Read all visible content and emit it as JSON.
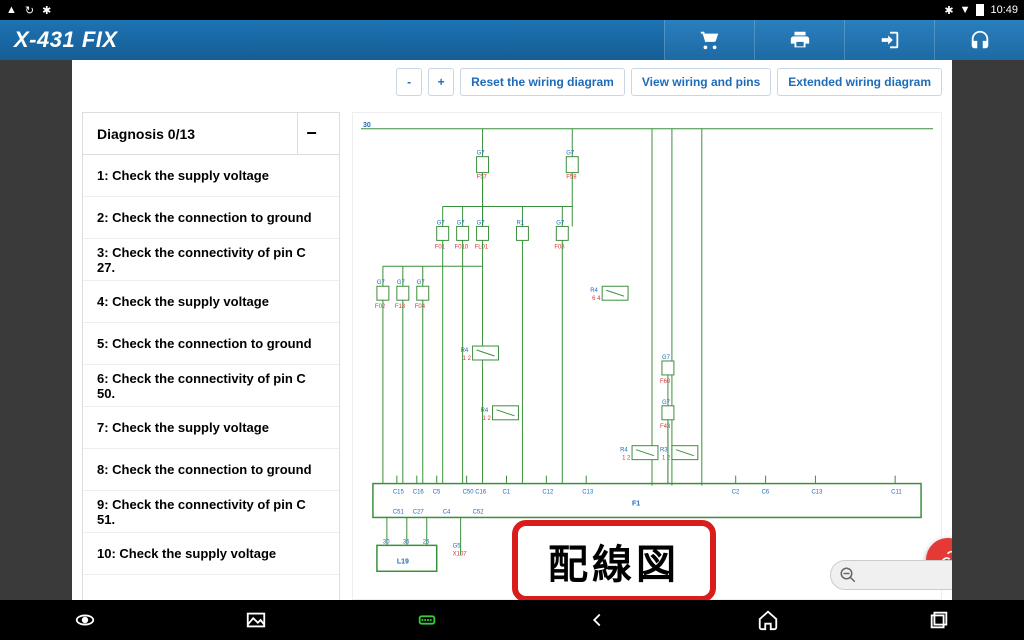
{
  "status": {
    "time": "10:49"
  },
  "header": {
    "title": "X-431 FIX"
  },
  "toolbar": {
    "minus": "-",
    "plus": "+",
    "reset": "Reset the wiring diagram",
    "view_pins": "View wiring and pins",
    "extended": "Extended wiring diagram"
  },
  "panel": {
    "title": "Diagnosis 0/13",
    "collapse_glyph": "−",
    "steps": [
      "1: Check the supply voltage",
      "2: Check the connection to ground",
      "3: Check the connectivity of pin C 27.",
      "4: Check the supply voltage",
      "5: Check the connection to ground",
      "6: Check the connectivity of pin C 50.",
      "7: Check the supply voltage",
      "8: Check the connection to ground",
      "9: Check the connectivity of pin C 51.",
      "10: Check the supply voltage"
    ]
  },
  "diagram": {
    "rail_label": "30",
    "components": {
      "top_fuses": [
        {
          "ref": "G7",
          "id": "F57"
        },
        {
          "ref": "G7",
          "id": "F58"
        }
      ],
      "mid_fuses": [
        {
          "ref": "G7",
          "id": "F01"
        },
        {
          "ref": "G7",
          "id": "F010"
        },
        {
          "ref": "G7",
          "id": "FL01"
        },
        {
          "ref": "R1",
          "id": ""
        },
        {
          "ref": "G7",
          "id": "F08"
        }
      ],
      "low_fuses": [
        {
          "ref": "G7",
          "id": "F02"
        },
        {
          "ref": "G7",
          "id": "F13"
        },
        {
          "ref": "G7",
          "id": "F04"
        }
      ],
      "relays": [
        {
          "ref": "R4",
          "pins": "1 2"
        },
        {
          "ref": "R4",
          "pins": "1 2"
        },
        {
          "ref": "R4",
          "pins": "6 4"
        },
        {
          "ref": "R4",
          "pins": "1 2"
        },
        {
          "ref": "R3",
          "pins": "1 2"
        }
      ],
      "right_fuses": [
        {
          "ref": "G7",
          "id": "F60"
        },
        {
          "ref": "G7",
          "id": "F43"
        }
      ],
      "bus": {
        "name": "F1",
        "pins_top": [
          "C15",
          "C16",
          "C5",
          "C50 C16",
          "C1",
          "C12",
          "C13",
          "C2",
          "C6",
          "C13",
          "C11"
        ],
        "pins_bot": [
          "C51",
          "C27",
          "C4",
          "C52"
        ]
      },
      "ground_block": {
        "name": "L19",
        "pins": [
          "30",
          "36",
          "25"
        ]
      },
      "aux": {
        "ref": "G5",
        "id": "X107"
      }
    }
  },
  "overlay": {
    "label": "配線図"
  }
}
